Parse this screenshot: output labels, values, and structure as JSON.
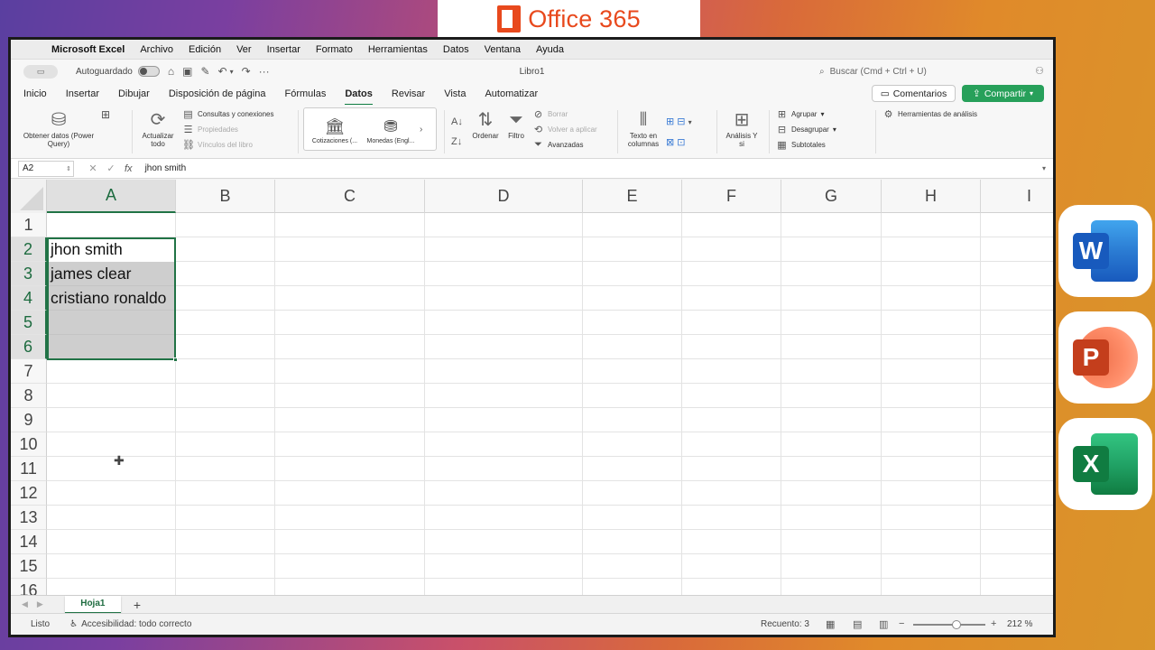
{
  "banner": {
    "brand": "Office 365"
  },
  "apps": [
    {
      "name": "word-app-icon",
      "letter": "W"
    },
    {
      "name": "powerpoint-app-icon",
      "letter": "P"
    },
    {
      "name": "excel-app-icon",
      "letter": "X"
    }
  ],
  "menubar": {
    "app": "Microsoft Excel",
    "items": [
      "Archivo",
      "Edición",
      "Ver",
      "Insertar",
      "Formato",
      "Herramientas",
      "Datos",
      "Ventana",
      "Ayuda"
    ]
  },
  "titlebar": {
    "autosave_label": "Autoguardado",
    "document": "Libro1",
    "search_placeholder": "Buscar (Cmd + Ctrl + U)"
  },
  "ribbon_tabs": {
    "items": [
      "Inicio",
      "Insertar",
      "Dibujar",
      "Disposición de página",
      "Fórmulas",
      "Datos",
      "Revisar",
      "Vista",
      "Automatizar"
    ],
    "active": "Datos",
    "comments": "Comentarios",
    "share": "Compartir"
  },
  "ribbon": {
    "get_data": "Obtener datos (Power Query)",
    "refresh_all": "Actualizar todo",
    "queries": "Consultas y conexiones",
    "properties": "Propiedades",
    "links": "Vínculos del libro",
    "stocks": "Cotizaciones (...",
    "currencies": "Monedas (Engl...",
    "sort": "Ordenar",
    "filter": "Filtro",
    "clear": "Borrar",
    "reapply": "Volver a aplicar",
    "advanced": "Avanzadas",
    "text_to_columns": "Texto en columnas",
    "what_if": "Análisis Y si",
    "group": "Agrupar",
    "ungroup": "Desagrupar",
    "subtotal": "Subtotales",
    "analysis_tools": "Herramientas de análisis"
  },
  "formula_bar": {
    "name_box": "A2",
    "fx": "fx",
    "formula": "jhon smith"
  },
  "columns": [
    "A",
    "B",
    "C",
    "D",
    "E",
    "F",
    "G",
    "H",
    "I"
  ],
  "rows": [
    "1",
    "2",
    "3",
    "4",
    "5",
    "6",
    "7",
    "8",
    "9",
    "10",
    "11",
    "12",
    "13",
    "14",
    "15",
    "16"
  ],
  "cells": {
    "A2": "jhon smith",
    "A3": "james clear",
    "A4": "cristiano ronaldo"
  },
  "sheet_tabs": {
    "active": "Hoja1"
  },
  "status": {
    "ready": "Listo",
    "accessibility": "Accesibilidad: todo correcto",
    "count": "Recuento: 3",
    "zoom": "212 %",
    "zoom_level": 0.6
  }
}
